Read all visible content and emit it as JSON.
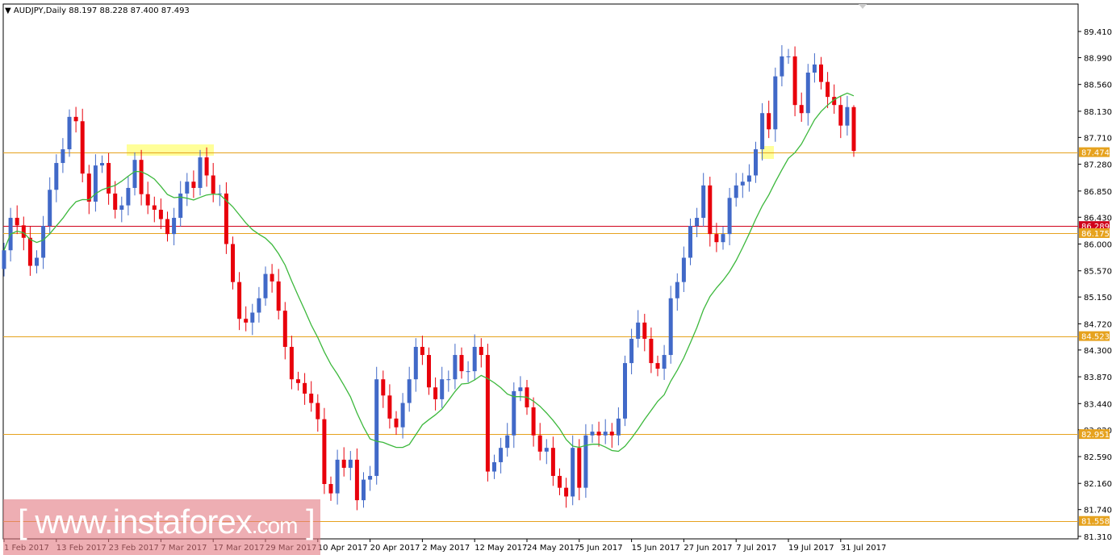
{
  "header": {
    "symbol": "AUDJPY,Daily",
    "ohlc": "88.197 88.228 87.400 87.493"
  },
  "watermark": {
    "open": "[",
    "site": "www.instaforex",
    "tld": ".com",
    "close": "]"
  },
  "colors": {
    "bull": "#4169c8",
    "bear": "#e8000b",
    "ma": "#3cb83c",
    "level": "#e6a21e",
    "level_red": "#d0021b",
    "highlight": "#ffff80"
  },
  "chart_data": {
    "type": "candlestick",
    "title": "AUDJPY,Daily",
    "ylim": [
      81.27,
      89.85
    ],
    "y_ticks": [
      "89.410",
      "88.990",
      "88.560",
      "88.130",
      "87.710",
      "87.280",
      "86.850",
      "86.430",
      "86.000",
      "85.570",
      "85.150",
      "84.720",
      "84.300",
      "83.870",
      "83.440",
      "83.020",
      "82.590",
      "82.160",
      "81.740",
      "81.310"
    ],
    "x_labels": [
      "1 Feb 2017",
      "13 Feb 2017",
      "23 Feb 2017",
      "7 Mar 2017",
      "17 Mar 2017",
      "29 Mar 2017",
      "10 Apr 2017",
      "20 Apr 2017",
      "2 May 2017",
      "12 May 2017",
      "24 May 2017",
      "5 Jun 2017",
      "15 Jun 2017",
      "27 Jun 2017",
      "7 Jul 2017",
      "19 Jul 2017",
      "31 Jul 2017"
    ],
    "x_label_every": 8,
    "closes": [
      85.9,
      86.42,
      86.3,
      86.1,
      85.65,
      85.78,
      86.29,
      86.87,
      87.3,
      87.52,
      88.04,
      87.97,
      87.13,
      86.68,
      87.26,
      87.3,
      86.81,
      86.55,
      86.62,
      86.9,
      87.35,
      86.8,
      86.62,
      86.55,
      86.4,
      86.16,
      86.42,
      86.81,
      87.0,
      86.9,
      87.39,
      87.1,
      86.81,
      86.81,
      86.0,
      85.39,
      84.8,
      84.74,
      84.9,
      85.13,
      85.52,
      85.4,
      84.93,
      84.35,
      83.83,
      83.77,
      83.6,
      83.45,
      83.19,
      82.15,
      82.0,
      82.54,
      82.41,
      82.54,
      81.89,
      82.22,
      82.28,
      83.83,
      83.57,
      83.2,
      83.06,
      83.45,
      83.83,
      84.35,
      84.22,
      83.7,
      83.51,
      83.83,
      83.83,
      84.22,
      83.96,
      83.96,
      84.35,
      84.22,
      82.35,
      82.5,
      82.73,
      82.93,
      83.64,
      83.7,
      83.38,
      82.93,
      82.67,
      82.73,
      82.28,
      82.09,
      81.95,
      82.73,
      82.09,
      82.93,
      82.99,
      82.93,
      82.99,
      82.93,
      83.2,
      84.09,
      84.48,
      84.74,
      84.48,
      84.09,
      84.0,
      84.22,
      85.13,
      85.39,
      85.78,
      86.29,
      86.42,
      86.94,
      86.16,
      86.03,
      86.16,
      86.74,
      86.94,
      87.0,
      87.1,
      87.52,
      88.1,
      87.84,
      88.69,
      89.01,
      89.01,
      88.23,
      88.1,
      88.75,
      88.88,
      88.6,
      88.36,
      88.23,
      87.9,
      88.197,
      87.493
    ],
    "first_open": 85.6,
    "last_candle": {
      "open": 88.197,
      "high": 88.228,
      "low": 87.4,
      "close": 87.493
    },
    "ma_period": 14,
    "levels": [
      {
        "value": 87.474,
        "label": "87.474",
        "color": "#e6a21e"
      },
      {
        "value": 86.289,
        "label": "86.289",
        "color": "#d0021b"
      },
      {
        "value": 86.175,
        "label": "86.175",
        "color": "#e6a21e"
      },
      {
        "value": 84.523,
        "label": "84.523",
        "color": "#e6a21e"
      },
      {
        "value": 82.951,
        "label": "82.951",
        "color": "#e6a21e"
      },
      {
        "value": 81.558,
        "label": "81.558",
        "color": "#e6a21e"
      }
    ]
  }
}
